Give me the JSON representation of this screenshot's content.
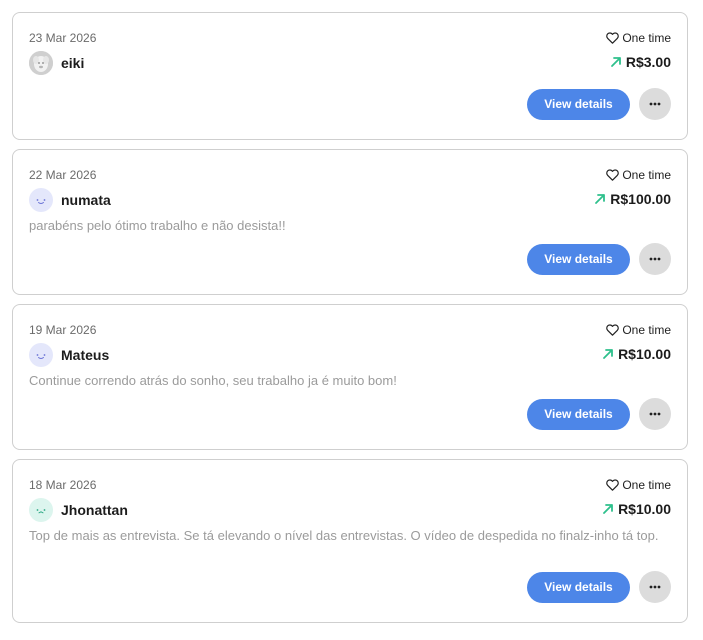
{
  "colors": {
    "accent": "#4d86e8",
    "arrow": "#2ec08c",
    "muted_text": "#9b9b9b",
    "border": "#cfcfcf",
    "more_button_bg": "#dcdcdc"
  },
  "icons": {
    "type_icon": "heart-outline-icon",
    "amount_icon": "arrow-up-right-icon",
    "more_icon": "more-horizontal-icon"
  },
  "donations": [
    {
      "date": "23 Mar 2026",
      "username": "eiki",
      "avatar": "photo-avatar",
      "type": "One time",
      "amount": "R$3.00",
      "message": "",
      "view_label": "View details"
    },
    {
      "date": "22 Mar 2026",
      "username": "numata",
      "avatar": "smiley-avatar-lilac",
      "type": "One time",
      "amount": "R$100.00",
      "message": "parabéns pelo ótimo trabalho e não desista!!",
      "view_label": "View details"
    },
    {
      "date": "19 Mar 2026",
      "username": "Mateus",
      "avatar": "smiley-avatar-lilac",
      "type": "One time",
      "amount": "R$10.00",
      "message": "Continue correndo atrás do sonho, seu trabalho ja é muito bom!",
      "view_label": "View details"
    },
    {
      "date": "18 Mar 2026",
      "username": "Jhonattan",
      "avatar": "smiley-avatar-mint",
      "type": "One time",
      "amount": "R$10.00",
      "message": "Top de mais as entrevista. Se tá elevando o nível das entrevistas. O vídeo de despedida no finalz-inho tá top.",
      "view_label": "View details"
    }
  ]
}
